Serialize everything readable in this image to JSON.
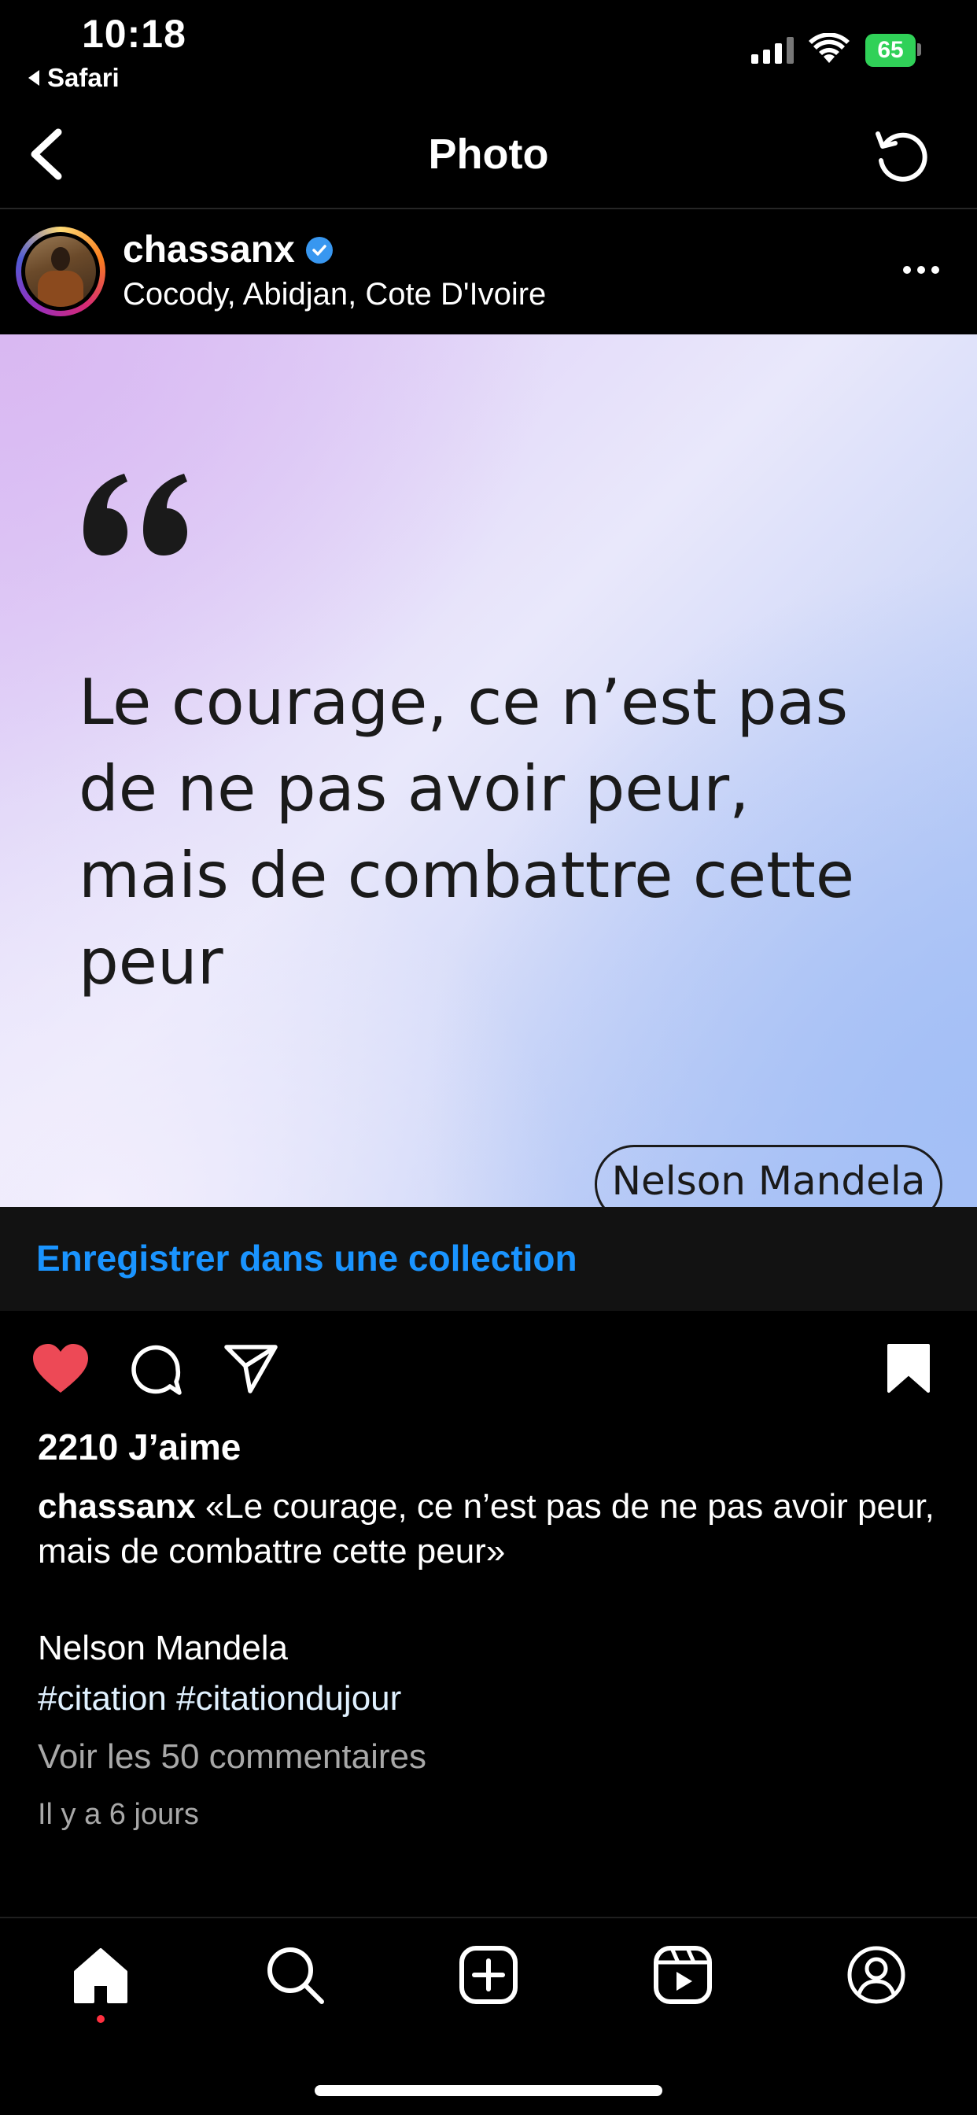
{
  "status_bar": {
    "time": "10:18",
    "back_app": "Safari",
    "battery": "65"
  },
  "nav": {
    "title": "Photo",
    "back_icon": "chevron-left-icon",
    "refresh_icon": "refresh-icon"
  },
  "post": {
    "username": "chassanx",
    "verified": true,
    "location": "Cocody, Abidjan, Cote D'Ivoire",
    "image": {
      "quote": "Le courage, ce n’est pas de ne pas avoir peur, mais de combattre cette peur",
      "author": "Nelson Mandela"
    },
    "save_collection_label": "Enregistrer dans une collection",
    "liked": true,
    "saved": true,
    "likes_label": "2210 J’aime",
    "caption_user": "chassanx",
    "caption_text": "«Le courage, ce n’est pas de ne pas avoir peur, mais de combattre cette peur»",
    "caption_author": "Nelson Mandela",
    "hashtags": "#citation #citationdujour",
    "view_comments": "Voir les 50 commentaires",
    "time_ago": "Il y a 6 jours"
  },
  "tab_bar": {
    "items": [
      "home-icon",
      "search-icon",
      "create-icon",
      "reels-icon",
      "profile-icon"
    ],
    "active": "home-icon"
  },
  "colors": {
    "accent_link": "#1a94ff",
    "like_red": "#ed4956",
    "verified_blue": "#3897f0",
    "battery_green": "#30d158"
  }
}
